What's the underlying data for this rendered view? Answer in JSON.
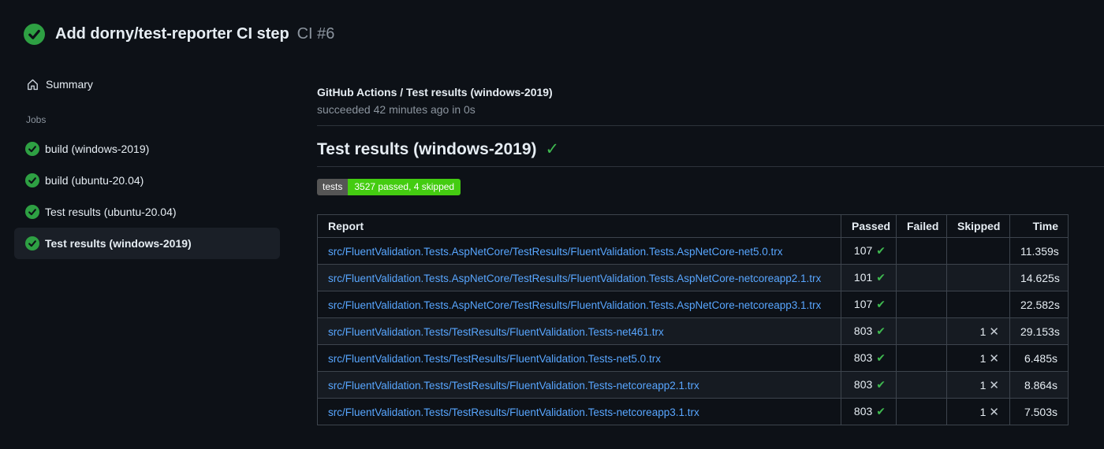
{
  "header": {
    "title": "Add dorny/test-reporter CI step",
    "run_number": "CI #6"
  },
  "sidebar": {
    "summary_label": "Summary",
    "jobs_label": "Jobs",
    "jobs": [
      {
        "label": "build (windows-2019)",
        "selected": false
      },
      {
        "label": "build (ubuntu-20.04)",
        "selected": false
      },
      {
        "label": "Test results (ubuntu-20.04)",
        "selected": false
      },
      {
        "label": "Test results (windows-2019)",
        "selected": true
      }
    ]
  },
  "main": {
    "breadcrumb": "GitHub Actions / Test results (windows-2019)",
    "status_line": "succeeded 42 minutes ago in 0s",
    "section_title": "Test results (windows-2019)",
    "badge": {
      "label": "tests",
      "value": "3527 passed, 4 skipped"
    },
    "table": {
      "columns": [
        "Report",
        "Passed",
        "Failed",
        "Skipped",
        "Time"
      ],
      "rows": [
        {
          "report": "src/FluentValidation.Tests.AspNetCore/TestResults/FluentValidation.Tests.AspNetCore-net5.0.trx",
          "passed": "107",
          "failed": "",
          "skipped": "",
          "time": "11.359s"
        },
        {
          "report": "src/FluentValidation.Tests.AspNetCore/TestResults/FluentValidation.Tests.AspNetCore-netcoreapp2.1.trx",
          "passed": "101",
          "failed": "",
          "skipped": "",
          "time": "14.625s"
        },
        {
          "report": "src/FluentValidation.Tests.AspNetCore/TestResults/FluentValidation.Tests.AspNetCore-netcoreapp3.1.trx",
          "passed": "107",
          "failed": "",
          "skipped": "",
          "time": "22.582s"
        },
        {
          "report": "src/FluentValidation.Tests/TestResults/FluentValidation.Tests-net461.trx",
          "passed": "803",
          "failed": "",
          "skipped": "1",
          "time": "29.153s"
        },
        {
          "report": "src/FluentValidation.Tests/TestResults/FluentValidation.Tests-net5.0.trx",
          "passed": "803",
          "failed": "",
          "skipped": "1",
          "time": "6.485s"
        },
        {
          "report": "src/FluentValidation.Tests/TestResults/FluentValidation.Tests-netcoreapp2.1.trx",
          "passed": "803",
          "failed": "",
          "skipped": "1",
          "time": "8.864s"
        },
        {
          "report": "src/FluentValidation.Tests/TestResults/FluentValidation.Tests-netcoreapp3.1.trx",
          "passed": "803",
          "failed": "",
          "skipped": "1",
          "time": "7.503s"
        }
      ]
    }
  },
  "icons": {
    "check_glyph": "✔",
    "x_glyph": "✕",
    "heading_check_glyph": "✓"
  },
  "colors": {
    "success_circle": "#2ea043",
    "success_check": "#3fb950",
    "badge_label_bg": "#555555",
    "badge_value_bg": "#44cc11",
    "link": "#58a6ff"
  }
}
